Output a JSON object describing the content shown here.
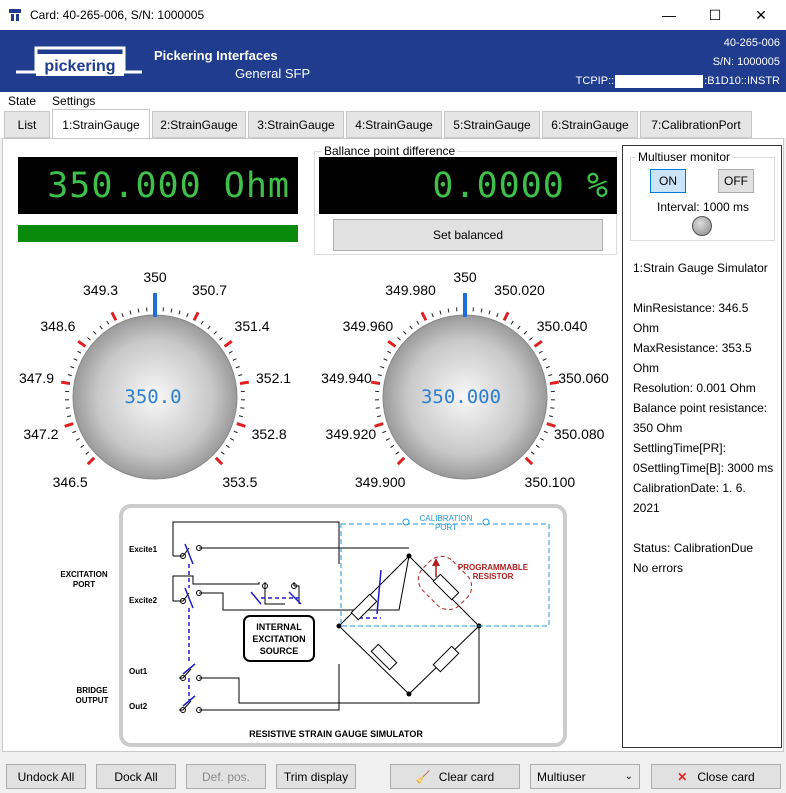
{
  "window": {
    "title": "Card: 40-265-006,  S/N: 1000005",
    "minimize": "—",
    "maximize": "☐",
    "close": "✕"
  },
  "banner": {
    "logo_text": "pickering",
    "brand_line1": "Pickering Interfaces",
    "brand_line2": "General SFP",
    "card": "40-265-006",
    "sn": "S/N: 1000005",
    "tcpip_prefix": "TCPIP::",
    "tcpip_suffix": ":B1D10::INSTR"
  },
  "menu": {
    "items": [
      "State",
      "Settings"
    ]
  },
  "tabs": [
    "List",
    "1:StrainGauge",
    "2:StrainGauge",
    "3:StrainGauge",
    "4:StrainGauge",
    "5:StrainGauge",
    "6:StrainGauge",
    "7:CalibrationPort"
  ],
  "active_tab": 1,
  "resistance_display": "350.000 Ohm",
  "balance": {
    "label": "Ballance point difference",
    "value": "0.0000 %",
    "button": "Set balanced"
  },
  "dial1": {
    "value": "350.0",
    "labels": [
      "346.5",
      "347.2",
      "347.9",
      "348.6",
      "349.3",
      "350",
      "350.7",
      "351.4",
      "352.1",
      "352.8",
      "353.5"
    ]
  },
  "dial2": {
    "value": "350.000",
    "labels": [
      "349.900",
      "349.920",
      "349.940",
      "349.960",
      "349.980",
      "350",
      "350.020",
      "350.040",
      "350.060",
      "350.080",
      "350.100"
    ]
  },
  "multiuser": {
    "label": "Multiuser monitor",
    "on": "ON",
    "off": "OFF",
    "interval": "Interval: 1000 ms"
  },
  "side_info": [
    "1:Strain Gauge Simulator",
    "",
    "MinResistance: 346.5",
    "Ohm",
    "MaxResistance: 353.5",
    "Ohm",
    "Resolution: 0.001 Ohm",
    "Balance point resistance:",
    "350 Ohm",
    "SettlingTime[PR]:",
    "0SettlingTime[B]: 3000 ms",
    "CalibrationDate: 1. 6.",
    "2021",
    "",
    "Status: CalibrationDue",
    "No errors"
  ],
  "diagram": {
    "title": "RESISTIVE STRAIN GAUGE SIMULATOR",
    "excitation_port": [
      "EXCITATION",
      "PORT"
    ],
    "bridge_output": [
      "BRIDGE",
      "OUTPUT"
    ],
    "excite1": "Excite1",
    "excite2": "Excite2",
    "out1": "Out1",
    "out2": "Out2",
    "source": [
      "INTERNAL",
      "EXCITATION",
      "SOURCE"
    ],
    "cal_port": [
      "CALIBRATION",
      "PORT"
    ],
    "prog_res": [
      "PROGRAMMABLE",
      "RESISTOR"
    ]
  },
  "bottom": {
    "undock": "Undock All",
    "dock": "Dock All",
    "defpos": "Def. pos.",
    "trim": "Trim display",
    "clear": "Clear card",
    "select": "Multiuser",
    "close": "Close card"
  },
  "colors": {
    "banner": "#1f3c8f",
    "lcd_text": "#3ec04a",
    "dial_value": "#2d7fd0",
    "tick_red": "#e02020",
    "cal_blue": "#1e9ad6",
    "prog_red": "#b02020"
  }
}
